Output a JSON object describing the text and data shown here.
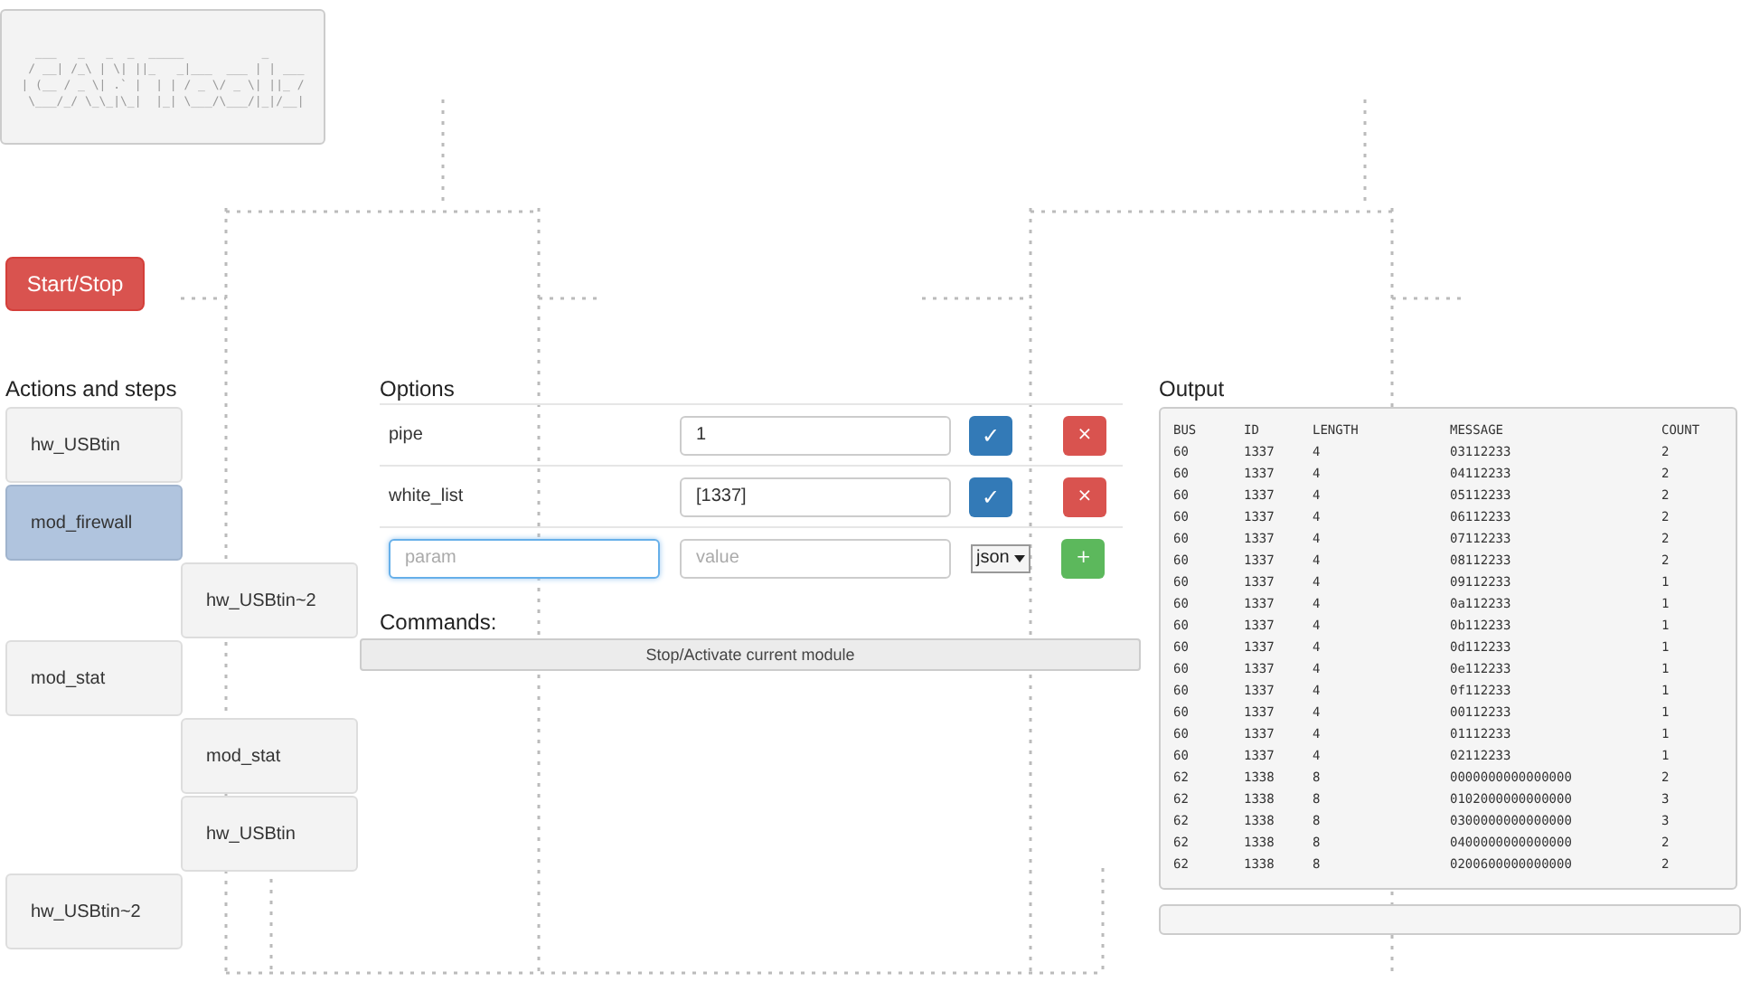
{
  "logo": {
    "art": [
      "  ___   _   _  _  _____           _     ",
      " / __| /_\\ | \\| ||_   _|___  ___ | | ___",
      "| (__ / _ \\| .` |  | | / _ \\/ _ \\| ||_ /",
      " \\___/_/ \\_\\_|\\_|  |_| \\___/\\___/|_|/__|"
    ]
  },
  "start_stop": {
    "label": "Start/Stop"
  },
  "actions": {
    "title": "Actions and steps",
    "items": [
      {
        "label": "hw_USBtin",
        "kind": "action",
        "selected": false
      },
      {
        "label": "mod_firewall",
        "kind": "action",
        "selected": true
      },
      {
        "label": "hw_USBtin~2",
        "kind": "step",
        "selected": false
      },
      {
        "label": "mod_stat",
        "kind": "action",
        "selected": false
      },
      {
        "label": "mod_stat",
        "kind": "step",
        "selected": false
      },
      {
        "label": "hw_USBtin",
        "kind": "step",
        "selected": false
      },
      {
        "label": "hw_USBtin~2",
        "kind": "action",
        "selected": false
      }
    ]
  },
  "options": {
    "title": "Options",
    "rows": [
      {
        "name": "pipe",
        "value": "1",
        "save": "✓",
        "remove": "×"
      },
      {
        "name": "white_list",
        "value": "[1337]",
        "save": "✓",
        "remove": "×"
      }
    ],
    "new_row": {
      "param_placeholder": "param",
      "value_placeholder": "value",
      "type": "json",
      "add": "+"
    }
  },
  "commands": {
    "title": "Commands:",
    "button": "Stop/Activate current module"
  },
  "output": {
    "title": "Output",
    "columns": [
      "BUS",
      "ID",
      "LENGTH",
      "MESSAGE",
      "COUNT"
    ],
    "rows": [
      [
        "60",
        "1337",
        "4",
        "03112233",
        "2"
      ],
      [
        "60",
        "1337",
        "4",
        "04112233",
        "2"
      ],
      [
        "60",
        "1337",
        "4",
        "05112233",
        "2"
      ],
      [
        "60",
        "1337",
        "4",
        "06112233",
        "2"
      ],
      [
        "60",
        "1337",
        "4",
        "07112233",
        "2"
      ],
      [
        "60",
        "1337",
        "4",
        "08112233",
        "2"
      ],
      [
        "60",
        "1337",
        "4",
        "09112233",
        "1"
      ],
      [
        "60",
        "1337",
        "4",
        "0a112233",
        "1"
      ],
      [
        "60",
        "1337",
        "4",
        "0b112233",
        "1"
      ],
      [
        "60",
        "1337",
        "4",
        "0d112233",
        "1"
      ],
      [
        "60",
        "1337",
        "4",
        "0e112233",
        "1"
      ],
      [
        "60",
        "1337",
        "4",
        "0f112233",
        "1"
      ],
      [
        "60",
        "1337",
        "4",
        "00112233",
        "1"
      ],
      [
        "60",
        "1337",
        "4",
        "01112233",
        "1"
      ],
      [
        "60",
        "1337",
        "4",
        "02112233",
        "1"
      ],
      [
        "62",
        "1338",
        "8",
        "0000000000000000",
        "2"
      ],
      [
        "62",
        "1338",
        "8",
        "0102000000000000",
        "3"
      ],
      [
        "62",
        "1338",
        "8",
        "0300000000000000",
        "3"
      ],
      [
        "62",
        "1338",
        "8",
        "0400000000000000",
        "2"
      ],
      [
        "62",
        "1338",
        "8",
        "0200600000000000",
        "2"
      ]
    ]
  }
}
